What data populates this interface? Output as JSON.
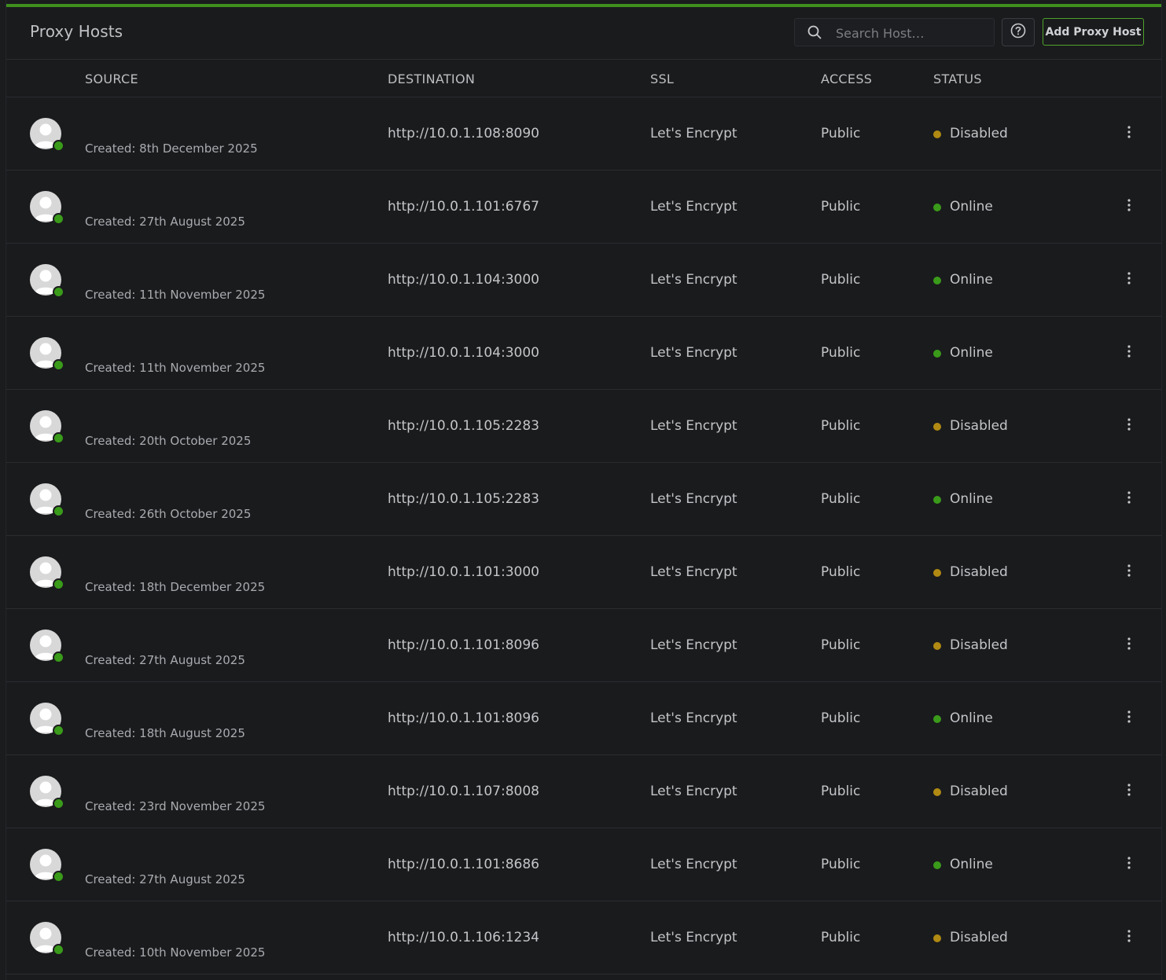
{
  "header": {
    "title": "Proxy Hosts",
    "search_placeholder": "Search Host…",
    "help_icon": "question-circle-icon",
    "add_button_label": "Add Proxy Host"
  },
  "colors": {
    "accent": "#3f8f1f",
    "online": "#3a9b1a",
    "disabled": "#b08a12"
  },
  "columns": {
    "source": "SOURCE",
    "destination": "DESTINATION",
    "ssl": "SSL",
    "access": "ACCESS",
    "status": "STATUS"
  },
  "rows": [
    {
      "created": "Created: 8th December 2025",
      "destination": "http://10.0.1.108:8090",
      "ssl": "Let's Encrypt",
      "access": "Public",
      "status": "Disabled"
    },
    {
      "created": "Created: 27th August 2025",
      "destination": "http://10.0.1.101:6767",
      "ssl": "Let's Encrypt",
      "access": "Public",
      "status": "Online"
    },
    {
      "created": "Created: 11th November 2025",
      "destination": "http://10.0.1.104:3000",
      "ssl": "Let's Encrypt",
      "access": "Public",
      "status": "Online"
    },
    {
      "created": "Created: 11th November 2025",
      "destination": "http://10.0.1.104:3000",
      "ssl": "Let's Encrypt",
      "access": "Public",
      "status": "Online"
    },
    {
      "created": "Created: 20th October 2025",
      "destination": "http://10.0.1.105:2283",
      "ssl": "Let's Encrypt",
      "access": "Public",
      "status": "Disabled"
    },
    {
      "created": "Created: 26th October 2025",
      "destination": "http://10.0.1.105:2283",
      "ssl": "Let's Encrypt",
      "access": "Public",
      "status": "Online"
    },
    {
      "created": "Created: 18th December 2025",
      "destination": "http://10.0.1.101:3000",
      "ssl": "Let's Encrypt",
      "access": "Public",
      "status": "Disabled"
    },
    {
      "created": "Created: 27th August 2025",
      "destination": "http://10.0.1.101:8096",
      "ssl": "Let's Encrypt",
      "access": "Public",
      "status": "Disabled"
    },
    {
      "created": "Created: 18th August 2025",
      "destination": "http://10.0.1.101:8096",
      "ssl": "Let's Encrypt",
      "access": "Public",
      "status": "Online"
    },
    {
      "created": "Created: 23rd November 2025",
      "destination": "http://10.0.1.107:8008",
      "ssl": "Let's Encrypt",
      "access": "Public",
      "status": "Disabled"
    },
    {
      "created": "Created: 27th August 2025",
      "destination": "http://10.0.1.101:8686",
      "ssl": "Let's Encrypt",
      "access": "Public",
      "status": "Online"
    },
    {
      "created": "Created: 10th November 2025",
      "destination": "http://10.0.1.106:1234",
      "ssl": "Let's Encrypt",
      "access": "Public",
      "status": "Disabled"
    }
  ]
}
